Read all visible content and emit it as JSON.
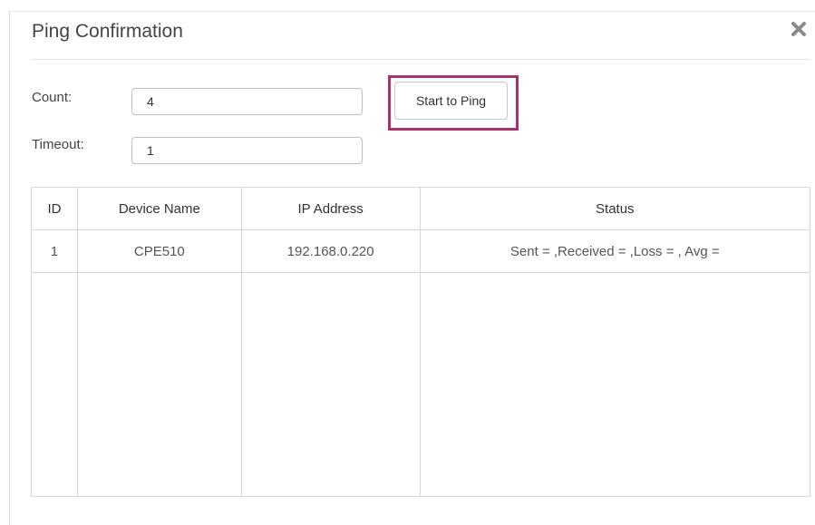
{
  "dialog": {
    "title": "Ping Confirmation",
    "close_icon": "close-icon"
  },
  "form": {
    "count_label": "Count:",
    "count_value": "4",
    "timeout_label": "Timeout:",
    "timeout_value": "1",
    "ping_button_label": "Start to Ping",
    "highlight_color": "#a8326b"
  },
  "table": {
    "headers": [
      "ID",
      "Device Name",
      "IP Address",
      "Status"
    ],
    "rows": [
      {
        "id": "1",
        "device_name": "CPE510",
        "ip_address": "192.168.0.220",
        "status": "Sent = ,Received = ,Loss = , Avg ="
      }
    ]
  }
}
